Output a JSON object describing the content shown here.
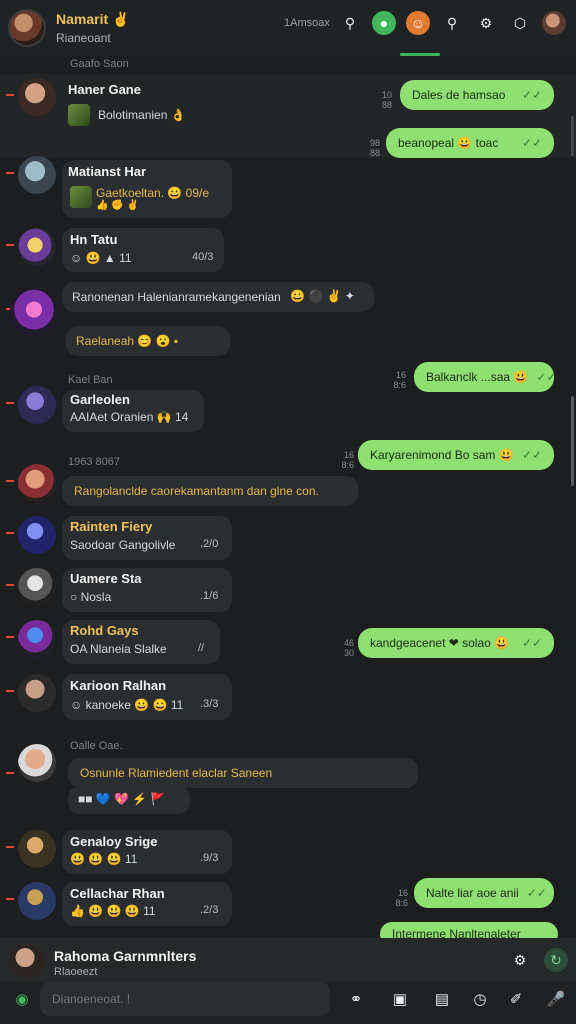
{
  "header": {
    "title": "Namarit ✌",
    "subtitle": "Rianeoant",
    "time": "1Amsoax"
  },
  "messages": [
    {
      "name": "Haner Gane",
      "preview": "Bolotimanien 👌"
    },
    {
      "name": "Matianst Har",
      "preview": "Gaetkoeltan. 😀  09/e",
      "meta": "👍 ✊ ✌"
    },
    {
      "name": "Hn Tatu",
      "preview": "☺ 😃 ▲  11",
      "meta": "40/3"
    },
    {
      "name": "Ranonenan Halenianramekangenenian",
      "preview": ""
    },
    {
      "name": "Raelaneah 😊 😮 ▪",
      "preview": ""
    },
    {
      "name": "Garleolen",
      "preview": "AAIAet Oranien 🙌 14"
    },
    {
      "name": "Rangolanclde caorekamantanm dan glne con.",
      "preview": ""
    },
    {
      "name": "Rainten Fiery",
      "preview": "Saodoar Gangolivle",
      "meta": ".2/0"
    },
    {
      "name": "Uamere Sta",
      "preview": "○ Nosla",
      "meta": ".1/6"
    },
    {
      "name": "Rohd Gays",
      "preview": "OA Nlaneia Slalke",
      "meta": "//"
    },
    {
      "name": "Karioon Ralhan",
      "preview": "☺ kanoeke 😀 😀 11",
      "meta": ".3/3"
    },
    {
      "name": "Osnunle Rlamiedent elaclar Saneen",
      "preview": "■■ 💙 💖 ⚡ 🚩"
    },
    {
      "name": "Genaloy Srige",
      "preview": "😃 😃 😃 11",
      "meta": ".9/3"
    },
    {
      "name": "Cellachar Rhan",
      "preview": "👍 😃 😃 😃 11",
      "meta": ".2/3"
    }
  ],
  "outgoing": [
    {
      "text": "Dales de hamsao",
      "stamp": "10\n88"
    },
    {
      "text": "beanopeal  😀 toac",
      "stamp": "98\n88"
    },
    {
      "text": "Balkanclk ...saa 😃",
      "stamp": "16\n8:6"
    },
    {
      "text": "Karyarenimond Bo   sam 😃",
      "stamp": "16\n8:6"
    },
    {
      "text": "kandgeacenet ❤ solao 😃",
      "stamp": "46\n30"
    },
    {
      "text": "Nalte liar aoe anii",
      "stamp": "16\n8:6"
    },
    {
      "text": "Intermene Nanltenaleter",
      "stamp": ""
    }
  ],
  "sections": {
    "s1": "Gaafo Saon",
    "s2": "Kael Ban",
    "s3": "1963 8067",
    "s4": "Oalle Oae."
  },
  "mini_player": {
    "title": "Rahoma Garnmnlters",
    "subtitle": "Rlaoeezt"
  },
  "composer": {
    "placeholder": "Dianoeneoat. !"
  }
}
